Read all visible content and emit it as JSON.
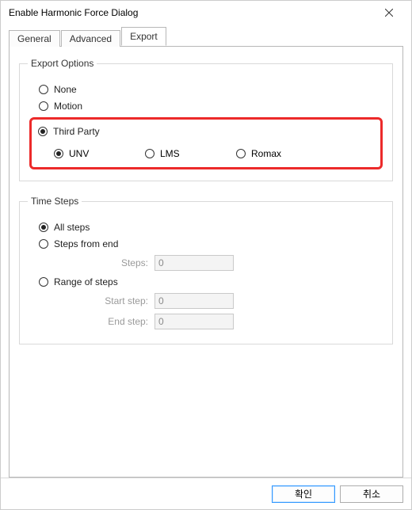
{
  "window": {
    "title": "Enable Harmonic Force Dialog"
  },
  "tabs": {
    "general": "General",
    "advanced": "Advanced",
    "export": "Export"
  },
  "exportOptions": {
    "legend": "Export Options",
    "none": "None",
    "motion": "Motion",
    "thirdParty": "Third Party",
    "unv": "UNV",
    "lms": "LMS",
    "romax": "Romax"
  },
  "timeSteps": {
    "legend": "Time Steps",
    "allSteps": "All steps",
    "stepsFromEnd": "Steps from end",
    "stepsLabel": "Steps:",
    "stepsValue": "0",
    "rangeOfSteps": "Range of steps",
    "startStepLabel": "Start step:",
    "startStepValue": "0",
    "endStepLabel": "End step:",
    "endStepValue": "0"
  },
  "buttons": {
    "ok": "확인",
    "cancel": "취소"
  }
}
